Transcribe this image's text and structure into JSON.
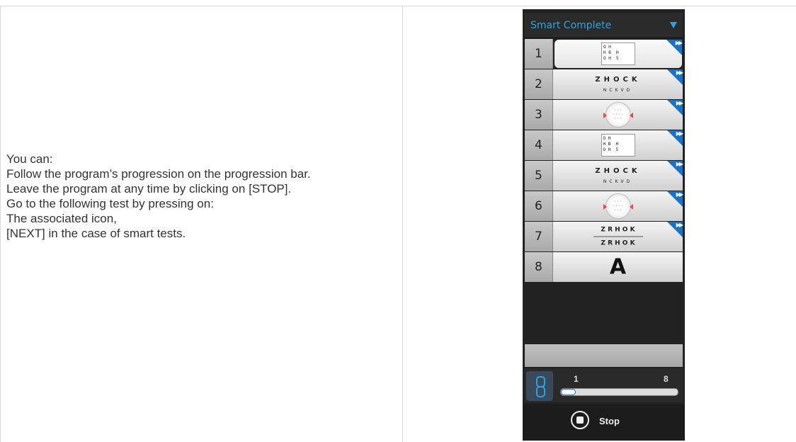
{
  "instructions": {
    "intro": "You can:",
    "items": [
      "Follow the program’s progression on the progression bar.",
      "Leave the program at any time by clicking on [STOP].",
      "Go to the following test by pressing on:"
    ],
    "subitems": [
      "The associated icon,",
      "[NEXT] in the case of smart tests."
    ]
  },
  "panel": {
    "program_name": "Smart Complete",
    "tests": [
      {
        "num": "1",
        "icon": "chart-icon",
        "smart": true
      },
      {
        "num": "2",
        "icon": "letter-line-icon",
        "smart": true,
        "line1": "ZHOCK",
        "line2": "NCKVD"
      },
      {
        "num": "3",
        "icon": "fixation-icon",
        "smart": true
      },
      {
        "num": "4",
        "icon": "chart-icon",
        "smart": true
      },
      {
        "num": "5",
        "icon": "letter-line-icon",
        "smart": true,
        "line1": "ZHOCK",
        "line2": "NCKVD"
      },
      {
        "num": "6",
        "icon": "fixation-icon",
        "smart": true
      },
      {
        "num": "7",
        "icon": "duochrome-icon",
        "smart": true,
        "line1": "Z R H O K",
        "line2": "Z R H O K"
      },
      {
        "num": "8",
        "icon": "letter-A-icon",
        "smart": false,
        "letter": "A"
      }
    ],
    "progress": {
      "start": "1",
      "end": "8",
      "fraction": 0.125
    },
    "stop_label": "Stop",
    "colors": {
      "accent": "#2ba3e0",
      "corner": "#1a73c7"
    }
  }
}
